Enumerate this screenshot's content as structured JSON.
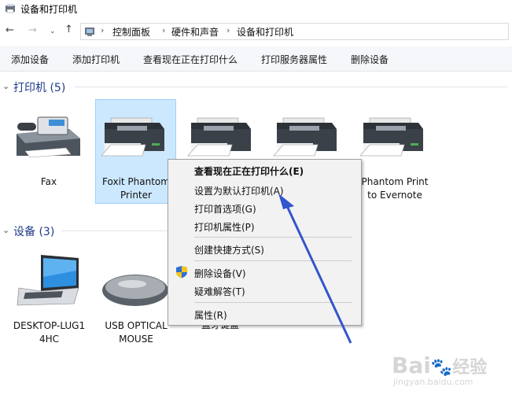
{
  "window": {
    "title": "设备和打印机"
  },
  "address": {
    "crumbs": [
      "控制面板",
      "硬件和声音",
      "设备和打印机"
    ]
  },
  "toolbar": {
    "items": [
      "添加设备",
      "添加打印机",
      "查看现在正在打印什么",
      "打印服务器属性",
      "删除设备"
    ]
  },
  "printers": {
    "header": "打印机 (5)",
    "items": [
      {
        "line1": "Fax",
        "line2": ""
      },
      {
        "line1": "Foxit Phantom",
        "line2": "Printer"
      },
      {
        "line1": "",
        "line2": ""
      },
      {
        "line1": "",
        "line2": ""
      },
      {
        "line1": "Phantom Print",
        "line2": "to Evernote"
      }
    ]
  },
  "devices": {
    "header": "设备 (3)",
    "items": [
      {
        "line1": "DESKTOP-LUG1",
        "line2": "4HC"
      },
      {
        "line1": "USB OPTICAL",
        "line2": "MOUSE"
      },
      {
        "line1": "蓝牙键盘",
        "line2": ""
      }
    ]
  },
  "context_menu": {
    "items": [
      "查看现在正在打印什么(E)",
      "设置为默认打印机(A)",
      "打印首选项(G)",
      "打印机属性(P)",
      "创建快捷方式(S)",
      "删除设备(V)",
      "疑难解答(T)",
      "属性(R)"
    ]
  },
  "watermark": {
    "brand": "Bai",
    "brand2": "经验",
    "url": "jingyan.baidu.com"
  },
  "colors": {
    "accent": "#1e3a8a",
    "selection": "#cce8ff",
    "arrow": "#3355cc"
  }
}
